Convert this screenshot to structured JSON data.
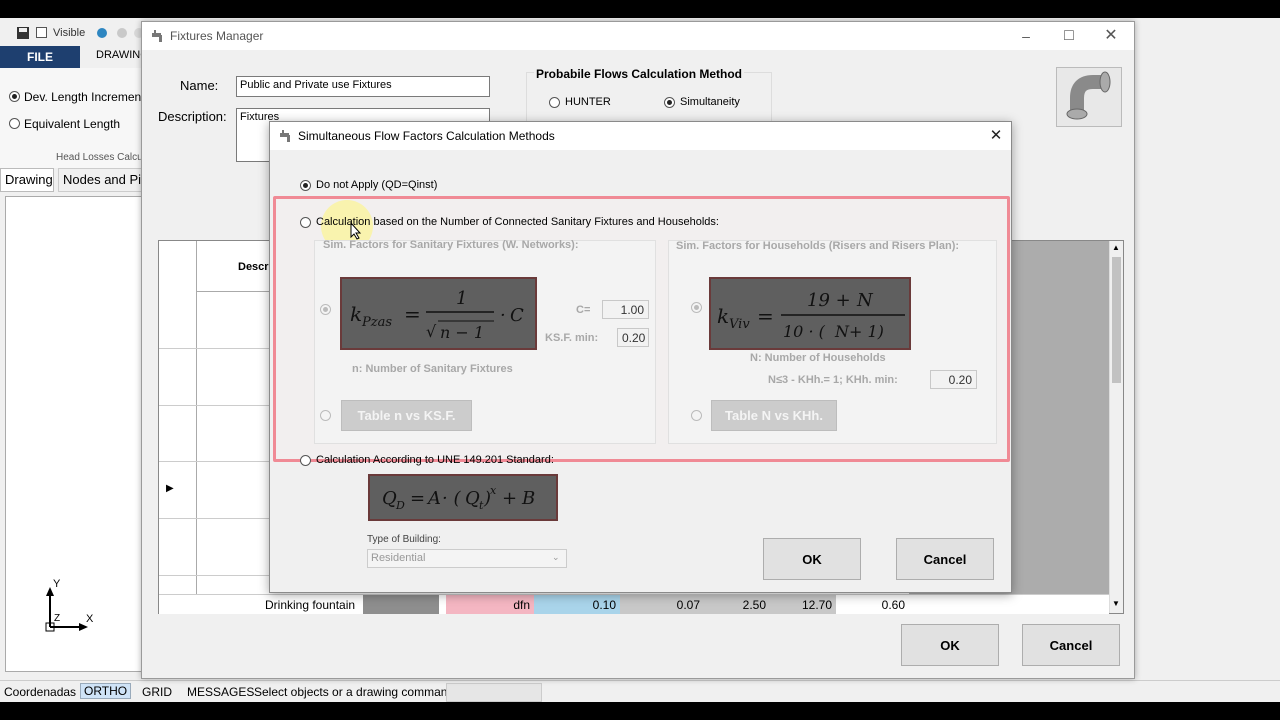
{
  "app": {
    "visible_label": "Visible",
    "file_tab": "FILE",
    "drawing_tab": "DRAWING",
    "ribbon": {
      "dev_length_label": "Dev. Length Increment:",
      "equiv_length_label": "Equivalent Length",
      "group_label": "Head Losses Calcu"
    },
    "doc_tabs": [
      "Drawing",
      "Nodes and Pip"
    ],
    "axis": {
      "y": "Y",
      "x": "X",
      "z": "Z"
    },
    "status": {
      "coords": "Coordenadas",
      "ortho": "ORTHO",
      "grid": "GRID",
      "messages": "MESSAGES",
      "prompt": "Select objects or a drawing command"
    }
  },
  "fixtures_manager": {
    "title": "Fixtures Manager",
    "name_label": "Name:",
    "name_value": "Public and Private use Fixtures",
    "description_label": "Description:",
    "description_value": "Fixtures",
    "method_group_title": "Probabile Flows Calculation Method",
    "method_options": [
      "HUNTER",
      "Simultaneity"
    ],
    "method_selected": "Simultaneity",
    "grid_header": "Descri",
    "visible_row": {
      "name": "Drinking fountain",
      "code": "dfn",
      "v1": "0.10",
      "v2": "0.07",
      "v3": "2.50",
      "v4": "12.70",
      "v5": "0.60"
    },
    "ok_label": "OK",
    "cancel_label": "Cancel",
    "colors": {
      "code_cell": "#f4b6c2",
      "flow_cell": "#a9d4ea",
      "grey_cell": "#c8c8c8"
    }
  },
  "dialog": {
    "title": "Simultaneous Flow Factors Calculation Methods",
    "option_none": "Do not Apply (QD=Qinst)",
    "option_connected": "Calculation based on the Number of Connected Sanitary Fixtures and Households:",
    "sanitary_title": "Sim. Factors for Sanitary Fixtures (W. Networks):",
    "households_title": "Sim. Factors for Households (Risers and Risers Plan):",
    "c_label": "C=",
    "c_value": "1.00",
    "ksf_label": "KS.F. min:",
    "ksf_value": "0.20",
    "n_note": "n: Number of Sanitary Fixtures",
    "N_note": "N: Number of Households",
    "khh_note": "N≤3 - KHh.= 1;  KHh. min:",
    "khh_value": "0.20",
    "table_n_button": "Table n vs KS.F.",
    "table_N_button": "Table N vs KHh.",
    "option_une": "Calculation According to UNE 149.201 Standard:",
    "building_label": "Type of Building:",
    "building_value": "Residential",
    "ok_label": "OK",
    "cancel_label": "Cancel",
    "selected_option": "Do not Apply (QD=Qinst)",
    "highlight_color": "#f08a95"
  }
}
